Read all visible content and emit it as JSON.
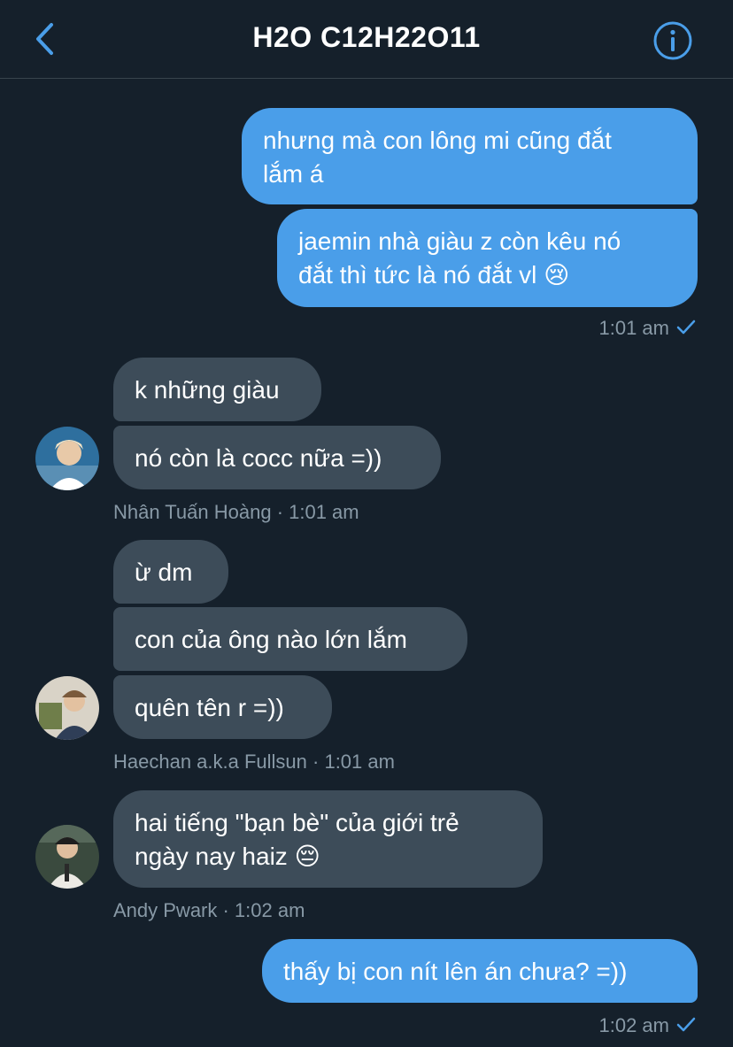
{
  "header": {
    "title": "H2O C12H22O11",
    "back_icon": "chevron-left-icon",
    "info_icon": "info-icon"
  },
  "colors": {
    "background": "#15202b",
    "outgoing_bubble": "#4a9ee9",
    "incoming_bubble": "#3d4c59",
    "meta_text": "#8899a6",
    "accent": "#4a9ee9"
  },
  "messages": {
    "m1": "nhưng mà con lông mi cũng đắt\nlắm á",
    "m2": "jaemin nhà giàu z còn kêu nó\nđắt thì tức là nó đắt vl 😢",
    "m2_time": "1:01 am",
    "m3": "k những giàu",
    "m4": "nó còn là cocc nữa =))",
    "m4_meta": "Nhân Tuấn Hoàng · 1:01 am",
    "m5": "ừ dm",
    "m6": "con của ông nào lớn lắm",
    "m7": "quên tên r =))",
    "m7_meta": "Haechan a.k.a Fullsun · 1:01 am",
    "m8": "hai tiếng \"bạn bè\" của giới trẻ\nngày nay haiz 😔",
    "m8_meta": "Andy Pwark · 1:02 am",
    "m9": "thấy bị con nít lên án chưa? =))",
    "m9_time": "1:02 am"
  },
  "read_icon": "checkmark-icon"
}
